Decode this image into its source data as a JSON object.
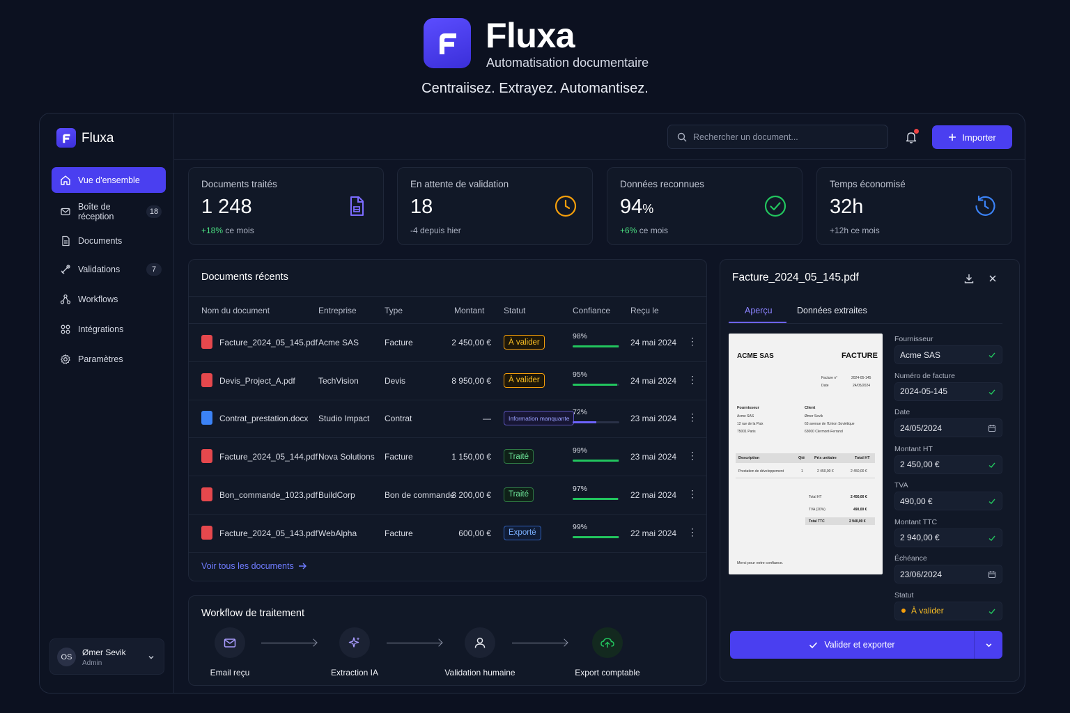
{
  "hero": {
    "title": "Fluxa",
    "subtitle": "Automatisation documentaire",
    "tagline": "Centraiisez. Extrayez. Automantisez."
  },
  "brand": {
    "name": "Fluxa",
    "accent": "#4a3ff0"
  },
  "sidebar": {
    "items": [
      {
        "label": "Vue d'ensemble",
        "icon": "home-icon",
        "active": true
      },
      {
        "label": "Boîte de réception",
        "icon": "mail-icon",
        "badge": "18"
      },
      {
        "label": "Documents",
        "icon": "file-icon"
      },
      {
        "label": "Validations",
        "icon": "check-stamp-icon",
        "badge": "7"
      },
      {
        "label": "Workflows",
        "icon": "workflow-icon"
      },
      {
        "label": "Intégrations",
        "icon": "integrations-icon"
      },
      {
        "label": "Paramètres",
        "icon": "gear-icon"
      }
    ],
    "user": {
      "initials": "OS",
      "name": "Ømer Sevik",
      "role": "Admin"
    }
  },
  "topbar": {
    "search_placeholder": "Rechercher un document...",
    "import_label": "Importer"
  },
  "stats": [
    {
      "label": "Documents traités",
      "value": "1 248",
      "unit": "",
      "delta": "+18%",
      "delta_suffix": " ce mois",
      "icon": "document-icon"
    },
    {
      "label": "En attente de validation",
      "value": "18",
      "unit": "",
      "delta": "",
      "delta_suffix": "-4 depuis hier",
      "icon": "clock-icon"
    },
    {
      "label": "Données reconnues",
      "value": "94",
      "unit": "%",
      "delta": "+6%",
      "delta_suffix": " ce mois",
      "icon": "check-circle-icon"
    },
    {
      "label": "Temps économisé",
      "value": "32h",
      "unit": "",
      "delta": "",
      "delta_suffix": "+12h ce mois",
      "icon": "time-refresh-icon"
    }
  ],
  "recent": {
    "title": "Documents récents",
    "columns": [
      "Nom du document",
      "Entreprise",
      "Type",
      "Montant",
      "Statut",
      "Confiance",
      "Reçu le"
    ],
    "rows": [
      {
        "name": "Facture_2024_05_145.pdf",
        "company": "Acme SAS",
        "type": "Facture",
        "amount": "2 450,00 €",
        "status": "À valider",
        "status_kind": "orange",
        "confidence": "98%",
        "confidence_value": 98,
        "received": "24 mai 2024",
        "file": "pdf"
      },
      {
        "name": "Devis_Project_A.pdf",
        "company": "TechVision",
        "type": "Devis",
        "amount": "8 950,00 €",
        "status": "À valider",
        "status_kind": "orange",
        "confidence": "95%",
        "confidence_value": 95,
        "received": "24 mai 2024",
        "file": "pdf"
      },
      {
        "name": "Contrat_prestation.docx",
        "company": "Studio Impact",
        "type": "Contrat",
        "amount": "—",
        "status": "Information manquante",
        "status_kind": "purple",
        "confidence": "72%",
        "confidence_value": 72,
        "received": "23 mai 2024",
        "file": "doc"
      },
      {
        "name": "Facture_2024_05_144.pdf",
        "company": "Nova Solutions",
        "type": "Facture",
        "amount": "1 150,00 €",
        "status": "Traité",
        "status_kind": "green",
        "confidence": "99%",
        "confidence_value": 99,
        "received": "23 mai 2024",
        "file": "pdf"
      },
      {
        "name": "Bon_commande_1023.pdf",
        "company": "BuildCorp",
        "type": "Bon de commande",
        "amount": "3 200,00 €",
        "status": "Traité",
        "status_kind": "green",
        "confidence": "97%",
        "confidence_value": 97,
        "received": "22 mai 2024",
        "file": "pdf"
      },
      {
        "name": "Facture_2024_05_143.pdf",
        "company": "WebAlpha",
        "type": "Facture",
        "amount": "600,00 €",
        "status": "Exporté",
        "status_kind": "blue",
        "confidence": "99%",
        "confidence_value": 99,
        "received": "22 mai 2024",
        "file": "pdf"
      }
    ],
    "see_all": "Voir tous les documents"
  },
  "workflow": {
    "title": "Workflow de traitement",
    "steps": [
      {
        "label": "Email reçu",
        "icon": "mail-icon"
      },
      {
        "label": "Extraction IA",
        "icon": "sparkles-icon"
      },
      {
        "label": "Validation humaine",
        "icon": "user-icon"
      },
      {
        "label": "Export comptable",
        "icon": "cloud-upload-icon"
      }
    ]
  },
  "document": {
    "filename": "Facture_2024_05_145.pdf",
    "tabs": [
      "Aperçu",
      "Données extraites"
    ],
    "preview": {
      "company": "ACME SAS",
      "doc_type": "FACTURE",
      "meta": [
        [
          "Facture n°",
          "2024-05-145"
        ],
        [
          "Date",
          "24/05/2024"
        ]
      ],
      "supplier_title": "Fournisseur",
      "supplier_lines": [
        "Acme SAS",
        "12 rue de la Paix",
        "75001 Paris"
      ],
      "client_title": "Client",
      "client_lines": [
        "Ømer Sevik",
        "63 avenue de l'Union Soviétique",
        "63000 Clermont-Ferrand"
      ],
      "table_head": [
        "Description",
        "Qté",
        "Prix unitaire",
        "Total HT"
      ],
      "table_row": [
        "Prestation de développement",
        "1",
        "2 450,00 €",
        "2 450,00 €"
      ],
      "totals": [
        [
          "Total HT",
          "2 450,00 €"
        ],
        [
          "TVA (20%)",
          "490,00 €"
        ],
        [
          "Total TTC",
          "2 940,00 €"
        ]
      ],
      "footer": "Merci pour votre confiance."
    },
    "fields": [
      {
        "label": "Fournisseur",
        "value": "Acme SAS",
        "icon": "check-icon"
      },
      {
        "label": "Numéro de facture",
        "value": "2024-05-145",
        "icon": "check-icon"
      },
      {
        "label": "Date",
        "value": "24/05/2024",
        "icon": "calendar-icon"
      },
      {
        "label": "Montant HT",
        "value": "2 450,00 €",
        "icon": "check-icon"
      },
      {
        "label": "TVA",
        "value": "490,00 €",
        "icon": "check-icon"
      },
      {
        "label": "Montant TTC",
        "value": "2 940,00 €",
        "icon": "check-icon"
      },
      {
        "label": "Échéance",
        "value": "23/06/2024",
        "icon": "calendar-icon"
      },
      {
        "label": "Statut",
        "value": "À valider",
        "icon": "check-icon",
        "dot": true
      }
    ],
    "validate_label": "Valider et exporter"
  }
}
